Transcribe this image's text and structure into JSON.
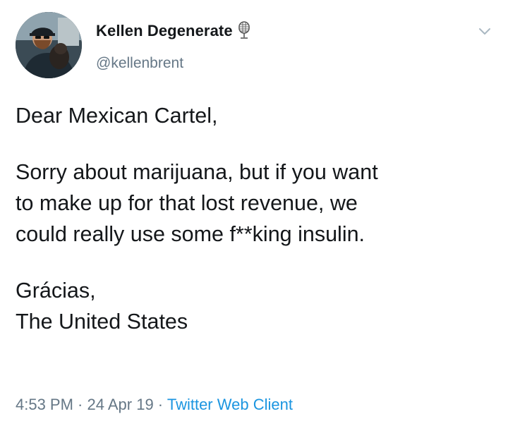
{
  "author": {
    "display_name": "Kellen Degenerate",
    "handle": "@kellenbrent",
    "badge_icon": "microphone-icon",
    "avatar_icon": "avatar-photo"
  },
  "menu": {
    "icon": "chevron-down-icon"
  },
  "tweet": {
    "greeting": "Dear Mexican Cartel,",
    "body_lines": [
      "Sorry about marijuana, but if you want",
      "to make up for that lost revenue, we",
      "could really use some f**king insulin."
    ],
    "signoff": "Grácias,",
    "signature": "The United States"
  },
  "meta": {
    "time": "4:53 PM",
    "separator_1": " · ",
    "date": "24 Apr 19",
    "separator_2": " · ",
    "client": "Twitter Web Client"
  },
  "colors": {
    "text": "#14171a",
    "secondary": "#657786",
    "link": "#1b95e0"
  }
}
